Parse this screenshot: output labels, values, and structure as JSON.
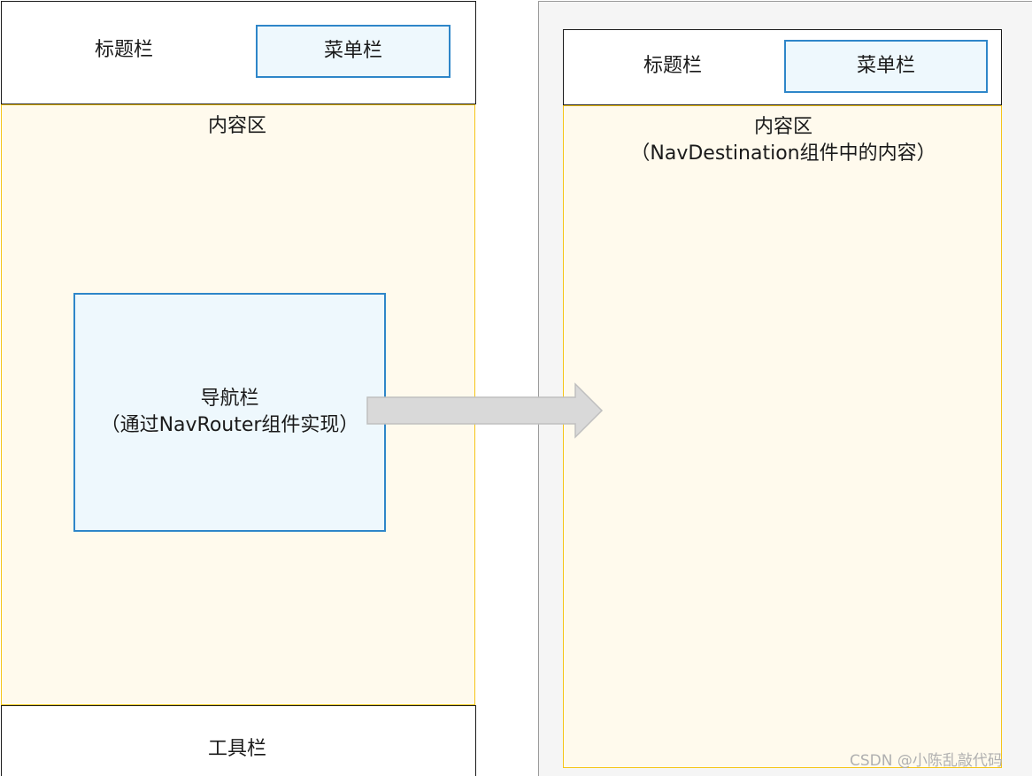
{
  "left_phone": {
    "title_bar_label": "标题栏",
    "menu_bar_label": "菜单栏",
    "content_label": "内容区",
    "nav_bar": {
      "line1": "导航栏",
      "line2": "（通过NavRouter组件实现）"
    },
    "toolbar_label": "工具栏"
  },
  "right_phone": {
    "title_bar_label": "标题栏",
    "menu_bar_label": "菜单栏",
    "content": {
      "line1": "内容区",
      "line2": "（NavDestination组件中的内容）"
    }
  },
  "watermark": "CSDN @小陈乱敲代码",
  "colors": {
    "blue_border": "#2e86c9",
    "blue_fill": "#eef8fd",
    "yellow_border": "#f5c518",
    "yellow_fill": "#fffaed",
    "arrow_fill": "#d9d9d9",
    "arrow_stroke": "#bfbfbf"
  },
  "icons": {
    "arrow": "right-arrow-icon"
  }
}
